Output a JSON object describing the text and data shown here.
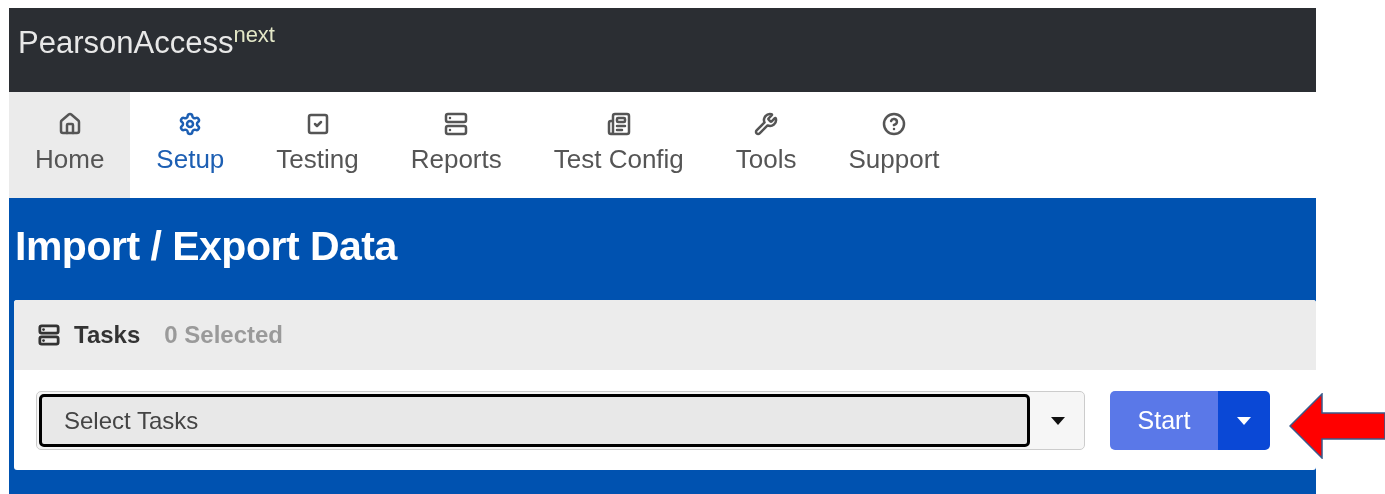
{
  "brand": {
    "name": "PearsonAccess",
    "superscript": "next"
  },
  "nav": [
    {
      "label": "Home",
      "selected": true,
      "current": false
    },
    {
      "label": "Setup",
      "selected": false,
      "current": true
    },
    {
      "label": "Testing",
      "selected": false,
      "current": false
    },
    {
      "label": "Reports",
      "selected": false,
      "current": false
    },
    {
      "label": "Test Config",
      "selected": false,
      "current": false
    },
    {
      "label": "Tools",
      "selected": false,
      "current": false
    },
    {
      "label": "Support",
      "selected": false,
      "current": false
    }
  ],
  "page_title": "Import / Export Data",
  "tasks_panel": {
    "title": "Tasks",
    "count": "0 Selected",
    "select": {
      "placeholder": "Select Tasks"
    },
    "start_button": "Start"
  }
}
